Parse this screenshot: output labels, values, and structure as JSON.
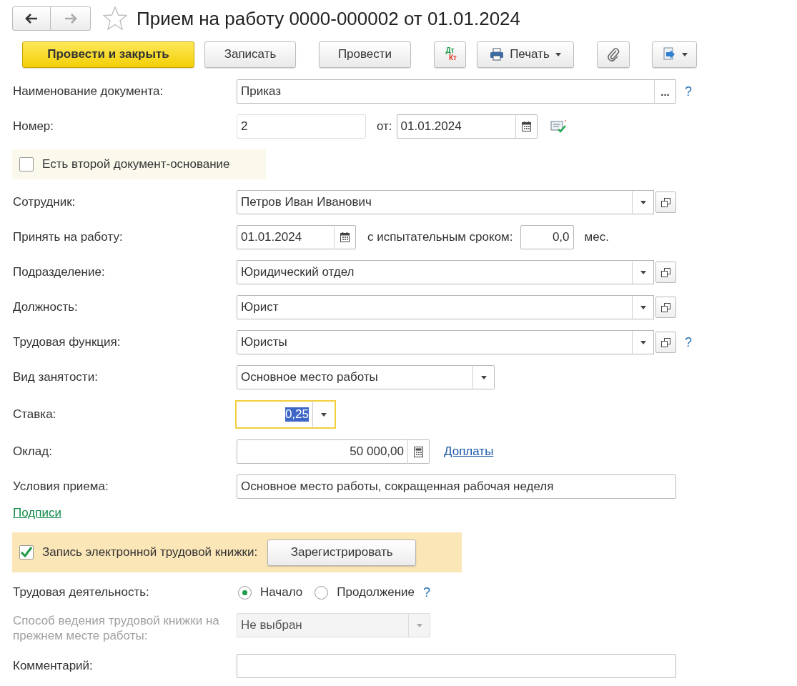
{
  "nav_buttons": [
    {
      "kind": "back",
      "disabled": false
    },
    {
      "kind": "forward",
      "disabled": true
    }
  ],
  "title": "Прием на работу 0000-000002 от 01.01.2024",
  "toolbar": [
    {
      "kind": "primary",
      "label": "Провести и закрыть"
    },
    {
      "kind": "plain",
      "label": "Записать"
    },
    {
      "kind": "plain",
      "label": "Провести"
    },
    {
      "kind": "dtkt",
      "top": "Дт",
      "bottom": "Кт"
    },
    {
      "kind": "print",
      "label": "Печать"
    },
    {
      "kind": "attach"
    },
    {
      "kind": "create-based"
    }
  ],
  "fields": [
    {
      "kind": "choice",
      "label": "Наименование документа:",
      "value": "Приказ",
      "button": "...",
      "help": "?"
    },
    {
      "kind": "number-date",
      "label": "Номер:",
      "value": "2",
      "date_label": "от:",
      "date": "01.01.2024"
    },
    {
      "kind": "checkbox-panel",
      "label": "Есть второй документ-основание",
      "checked": false
    },
    {
      "kind": "ref",
      "label": "Сотрудник:",
      "value": "Петров Иван Иванович"
    },
    {
      "kind": "hire-date",
      "label": "Принять на работу:",
      "date": "01.01.2024",
      "trial_label": "с испытательным сроком:",
      "trial": "0,0",
      "unit": "мес."
    },
    {
      "kind": "ref",
      "label": "Подразделение:",
      "value": "Юридический отдел"
    },
    {
      "kind": "ref",
      "label": "Должность:",
      "value": "Юрист"
    },
    {
      "kind": "ref",
      "label": "Трудовая функция:",
      "value": "Юристы",
      "help": "?"
    },
    {
      "kind": "select",
      "label": "Вид занятости:",
      "value": "Основное место работы",
      "disabled": false
    },
    {
      "kind": "rate",
      "label": "Ставка:",
      "value": "0,25",
      "focused": true
    },
    {
      "kind": "salary",
      "label": "Оклад:",
      "value": "50 000,00",
      "link": "Доплаты"
    },
    {
      "kind": "text",
      "label": "Условия приема:",
      "value": "Основное место работы, сокращенная рабочая неделя"
    },
    {
      "kind": "link",
      "label": "Подписи"
    },
    {
      "kind": "etk-panel",
      "label": "Запись электронной трудовой книжки:",
      "checked": true,
      "button": "Зарегистрировать"
    },
    {
      "kind": "radio",
      "label": "Трудовая деятельность:",
      "options": [
        {
          "label": "Начало",
          "selected": true
        },
        {
          "label": "Продолжение",
          "selected": false
        }
      ],
      "help": "?"
    },
    {
      "kind": "method-select",
      "label": "Способ ведения трудовой книжки на прежнем месте работы:",
      "value": "Не выбран",
      "disabled": true
    },
    {
      "kind": "text",
      "label": "Комментарий:"
    }
  ]
}
